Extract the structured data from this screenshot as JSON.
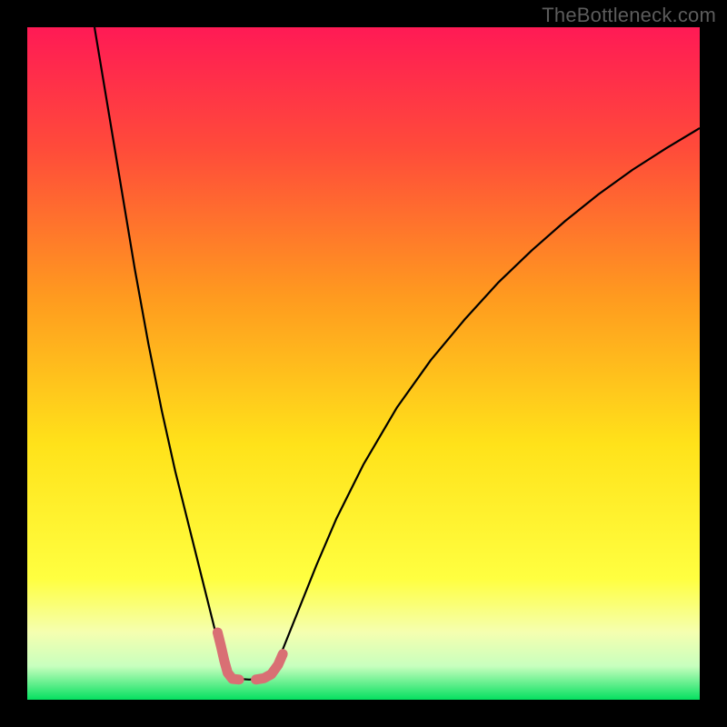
{
  "watermark": "TheBottleneck.com",
  "chart_data": {
    "type": "line",
    "title": "",
    "xlabel": "",
    "ylabel": "",
    "x_range": [
      0,
      100
    ],
    "y_range": [
      0,
      100
    ],
    "notch_x": 30,
    "gradient_stops": [
      {
        "offset": 0.0,
        "color": "#ff1a55"
      },
      {
        "offset": 0.18,
        "color": "#ff4b3a"
      },
      {
        "offset": 0.4,
        "color": "#ff9a1f"
      },
      {
        "offset": 0.62,
        "color": "#ffe21a"
      },
      {
        "offset": 0.82,
        "color": "#ffff40"
      },
      {
        "offset": 0.9,
        "color": "#f5ffb0"
      },
      {
        "offset": 0.95,
        "color": "#c8ffbe"
      },
      {
        "offset": 1.0,
        "color": "#05e060"
      }
    ],
    "series": [
      {
        "name": "left-curve",
        "stroke": "#000000",
        "width": 2.2,
        "points": [
          {
            "x": 10.0,
            "y": 100.0
          },
          {
            "x": 12.0,
            "y": 88.0
          },
          {
            "x": 14.0,
            "y": 76.0
          },
          {
            "x": 16.0,
            "y": 64.0
          },
          {
            "x": 18.0,
            "y": 53.0
          },
          {
            "x": 20.0,
            "y": 43.0
          },
          {
            "x": 22.0,
            "y": 34.0
          },
          {
            "x": 24.0,
            "y": 26.0
          },
          {
            "x": 25.0,
            "y": 22.0
          },
          {
            "x": 26.0,
            "y": 18.0
          },
          {
            "x": 27.0,
            "y": 14.0
          },
          {
            "x": 28.0,
            "y": 10.0
          },
          {
            "x": 28.5,
            "y": 8.0
          },
          {
            "x": 29.0,
            "y": 6.0
          },
          {
            "x": 29.5,
            "y": 4.2
          },
          {
            "x": 30.0,
            "y": 3.2
          }
        ]
      },
      {
        "name": "notch-floor",
        "stroke": "#000000",
        "width": 2.2,
        "points": [
          {
            "x": 30.0,
            "y": 3.2
          },
          {
            "x": 33.0,
            "y": 3.0
          },
          {
            "x": 36.0,
            "y": 3.2
          }
        ]
      },
      {
        "name": "right-curve",
        "stroke": "#000000",
        "width": 2.2,
        "points": [
          {
            "x": 36.0,
            "y": 3.2
          },
          {
            "x": 37.0,
            "y": 5.0
          },
          {
            "x": 38.0,
            "y": 7.5
          },
          {
            "x": 40.0,
            "y": 12.5
          },
          {
            "x": 43.0,
            "y": 20.0
          },
          {
            "x": 46.0,
            "y": 27.0
          },
          {
            "x": 50.0,
            "y": 35.0
          },
          {
            "x": 55.0,
            "y": 43.5
          },
          {
            "x": 60.0,
            "y": 50.5
          },
          {
            "x": 65.0,
            "y": 56.5
          },
          {
            "x": 70.0,
            "y": 62.0
          },
          {
            "x": 75.0,
            "y": 66.8
          },
          {
            "x": 80.0,
            "y": 71.2
          },
          {
            "x": 85.0,
            "y": 75.2
          },
          {
            "x": 90.0,
            "y": 78.8
          },
          {
            "x": 95.0,
            "y": 82.0
          },
          {
            "x": 100.0,
            "y": 85.0
          }
        ]
      },
      {
        "name": "highlight-left",
        "stroke": "#d96f74",
        "width": 11,
        "cap": "round",
        "points": [
          {
            "x": 28.3,
            "y": 10.0
          },
          {
            "x": 28.8,
            "y": 8.0
          },
          {
            "x": 29.3,
            "y": 5.8
          },
          {
            "x": 29.8,
            "y": 4.0
          },
          {
            "x": 30.5,
            "y": 3.1
          },
          {
            "x": 31.5,
            "y": 3.0
          }
        ]
      },
      {
        "name": "highlight-right",
        "stroke": "#d96f74",
        "width": 11,
        "cap": "round",
        "points": [
          {
            "x": 34.0,
            "y": 3.0
          },
          {
            "x": 35.2,
            "y": 3.2
          },
          {
            "x": 36.3,
            "y": 3.8
          },
          {
            "x": 37.3,
            "y": 5.2
          },
          {
            "x": 38.0,
            "y": 6.8
          }
        ]
      }
    ]
  }
}
